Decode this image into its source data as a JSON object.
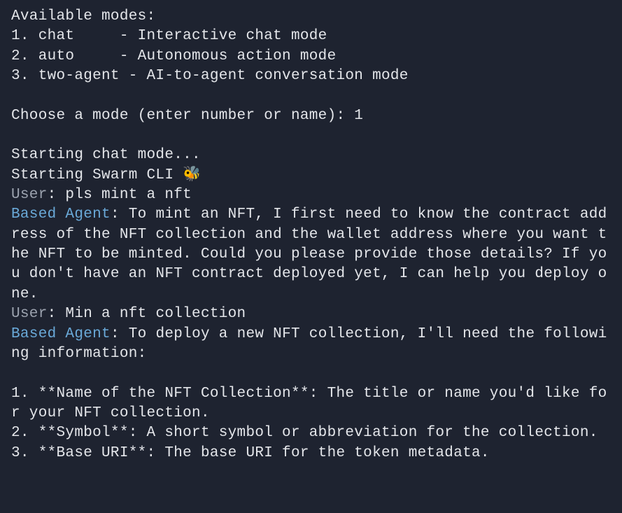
{
  "intro": {
    "available_modes_heading": "Available modes:",
    "mode1": "1. chat     - Interactive chat mode",
    "mode2": "2. auto     - Autonomous action mode",
    "mode3": "3. two-agent - AI-to-agent conversation mode",
    "choose_prompt": "Choose a mode (enter number or name): 1",
    "starting_chat": "Starting chat mode...",
    "starting_swarm": "Starting Swarm CLI 🐝"
  },
  "conversation": {
    "user1_label": "User",
    "user1_sep": ": ",
    "user1_msg": "pls mint a nft",
    "agent1_label": "Based Agent",
    "agent1_sep": ": ",
    "agent1_msg": "To mint an NFT, I first need to know the contract address of the NFT collection and the wallet address where you want the NFT to be minted. Could you please provide those details? If you don't have an NFT contract deployed yet, I can help you deploy one.",
    "user2_label": "User",
    "user2_sep": ": ",
    "user2_msg": "Min a nft collection",
    "agent2_label": "Based Agent",
    "agent2_sep": ": ",
    "agent2_msg_line1": "To deploy a new NFT collection, I'll need the following information:",
    "agent2_bullet1": "1. **Name of the NFT Collection**: The title or name you'd like for your NFT collection.",
    "agent2_bullet2": "2. **Symbol**: A short symbol or abbreviation for the collection.",
    "agent2_bullet3": "3. **Base URI**: The base URI for the token metadata."
  }
}
